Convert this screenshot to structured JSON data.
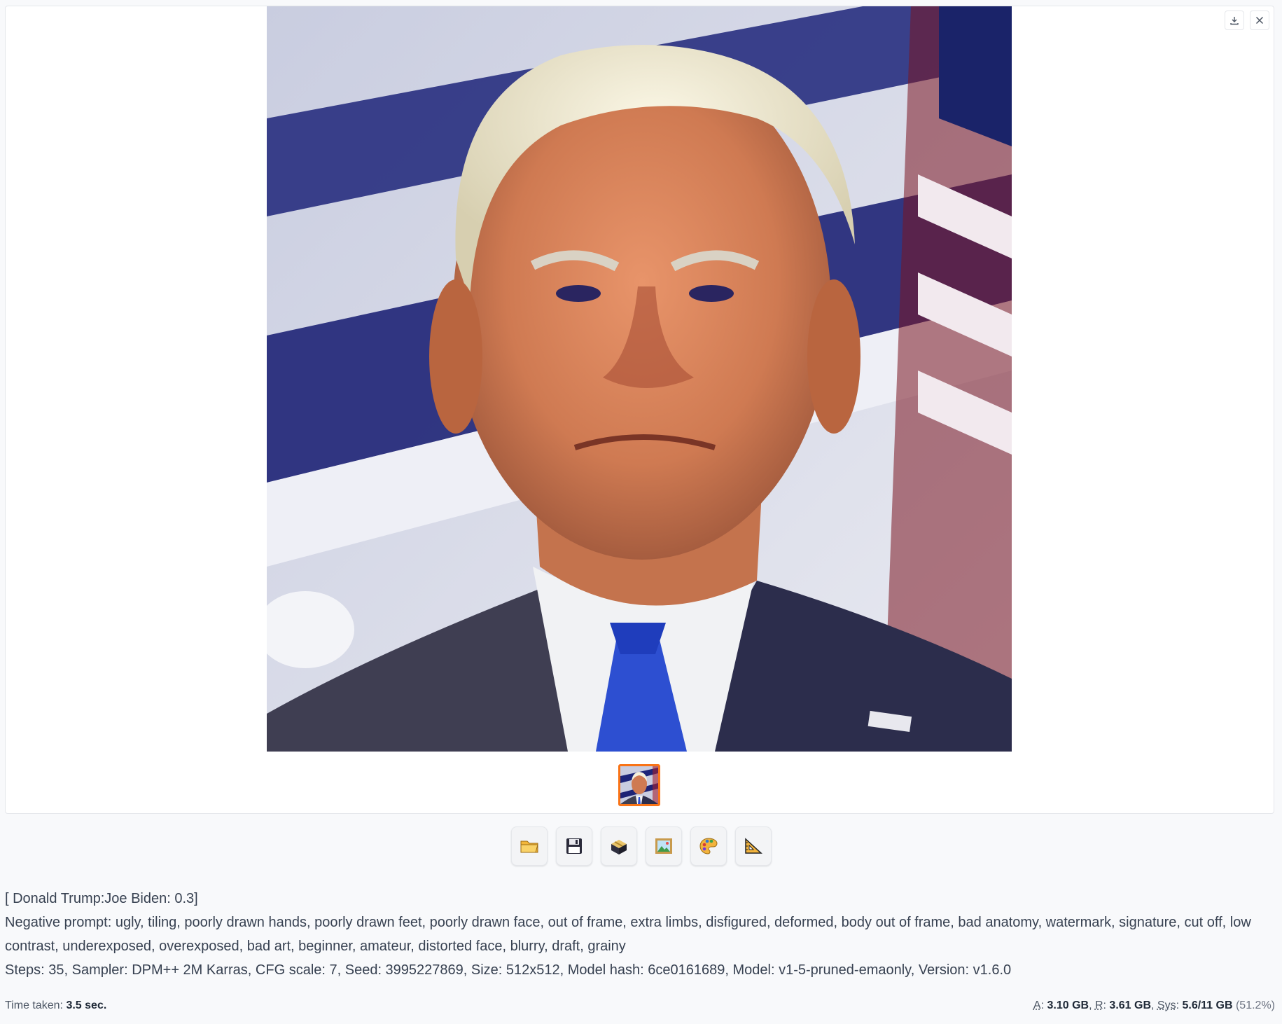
{
  "gallery": {
    "download_icon": "download-icon",
    "close_icon": "close-icon",
    "image_alt": "Generated portrait",
    "thumbnail_selected": true
  },
  "toolbar": {
    "buttons": [
      {
        "name": "open-folder",
        "icon": "folder-icon"
      },
      {
        "name": "save",
        "icon": "floppy-disk-icon"
      },
      {
        "name": "zip",
        "icon": "package-icon"
      },
      {
        "name": "send-to-img2img",
        "icon": "picture-icon"
      },
      {
        "name": "send-to-inpaint",
        "icon": "palette-icon"
      },
      {
        "name": "send-to-extras",
        "icon": "triangle-ruler-icon"
      }
    ]
  },
  "info": {
    "prompt": "[ Donald Trump:Joe Biden: 0.3]",
    "negative_prompt": "Negative prompt: ugly, tiling, poorly drawn hands, poorly drawn feet, poorly drawn face, out of frame, extra limbs, disfigured, deformed, body out of frame, bad anatomy, watermark, signature, cut off, low contrast, underexposed, overexposed, bad art, beginner, amateur, distorted face, blurry, draft, grainy",
    "params": "Steps: 35, Sampler: DPM++ 2M Karras, CFG scale: 7, Seed: 3995227869, Size: 512x512, Model hash: 6ce0161689, Model: v1-5-pruned-emaonly, Version: v1.6.0"
  },
  "footer": {
    "time_label": "Time taken:",
    "time_value": "3.5 sec.",
    "a_label": "A",
    "a_value": "3.10 GB",
    "r_label": "R",
    "r_value": "3.61 GB",
    "sys_label": "Sys",
    "sys_value": "5.6/11 GB",
    "sys_pct": "(51.2%)"
  },
  "colors": {
    "accent": "#f97316",
    "background": "#f8f9fb"
  }
}
